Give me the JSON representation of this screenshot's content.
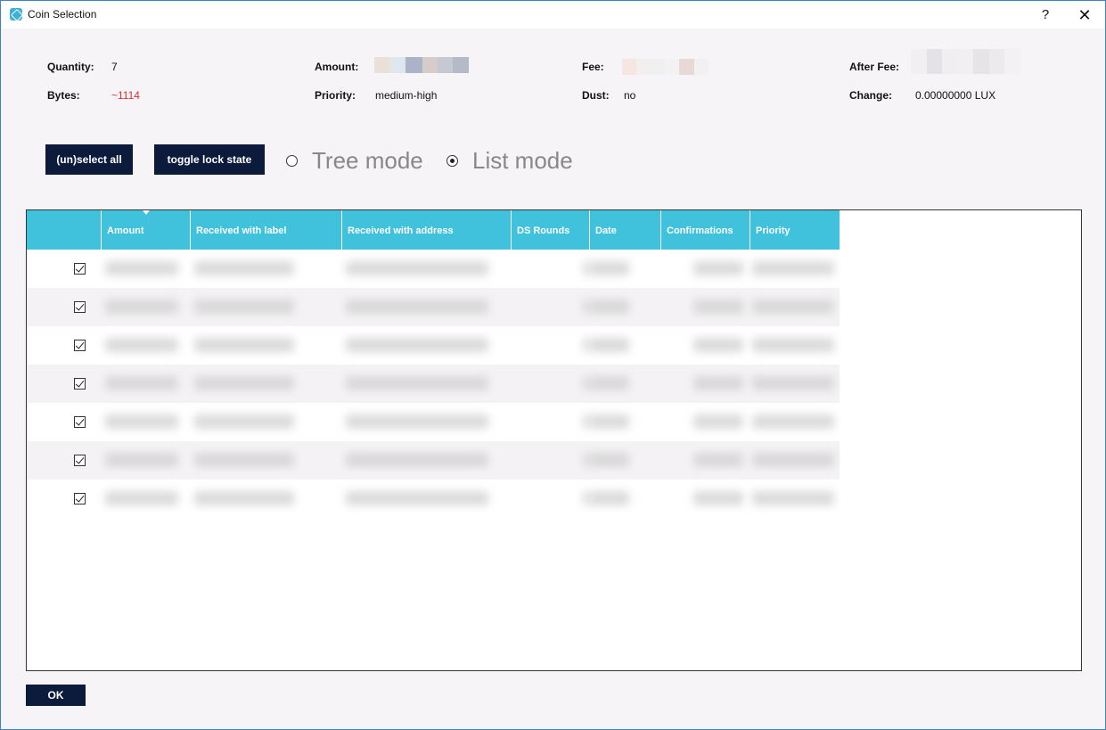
{
  "window": {
    "title": "Coin Selection",
    "help_label": "?",
    "close_label": "✕"
  },
  "summary": {
    "quantity_label": "Quantity:",
    "quantity_value": "7",
    "bytes_label": "Bytes:",
    "bytes_value": "~1114",
    "amount_label": "Amount:",
    "priority_label": "Priority:",
    "priority_value": "medium-high",
    "fee_label": "Fee:",
    "dust_label": "Dust:",
    "dust_value": "no",
    "after_fee_label": "After Fee:",
    "change_label": "Change:",
    "change_value": "0.00000000 LUX"
  },
  "controls": {
    "unselect_all": "(un)select all",
    "toggle_lock": "toggle lock state",
    "tree_mode": "Tree mode",
    "list_mode": "List mode",
    "selected_mode": "list"
  },
  "table": {
    "columns": [
      "Amount",
      "Received with label",
      "Received with address",
      "DS Rounds",
      "Date",
      "Confirmations",
      "Priority"
    ],
    "rows": [
      {
        "checked": true
      },
      {
        "checked": true
      },
      {
        "checked": true
      },
      {
        "checked": true
      },
      {
        "checked": true
      },
      {
        "checked": true
      },
      {
        "checked": true
      }
    ]
  },
  "footer": {
    "ok_label": "OK"
  },
  "colors": {
    "header_bg": "#40c1dc",
    "button_bg": "#0c1b3c",
    "bytes_warning": "#e03030"
  }
}
